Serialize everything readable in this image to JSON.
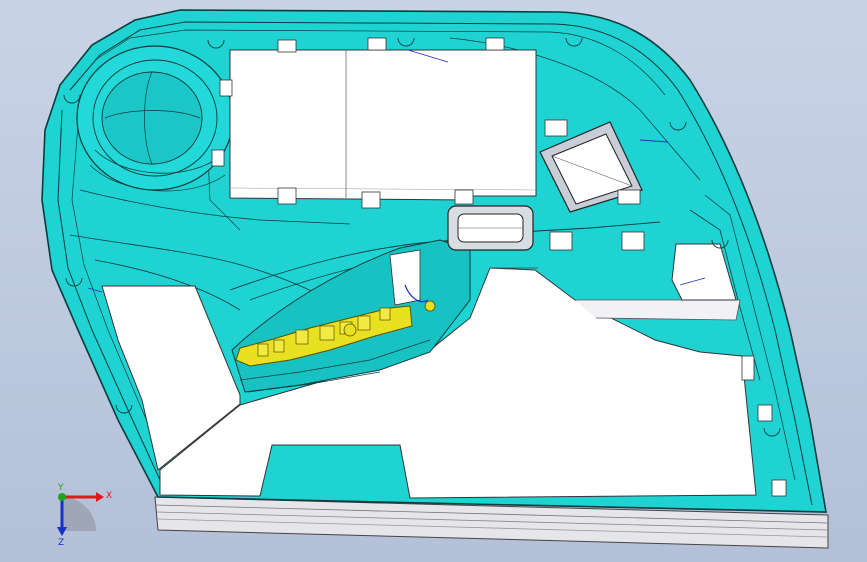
{
  "scene": {
    "background_top": "#c9d3e6",
    "background_bottom": "#b4c0d8",
    "part_color": "#1fd3d3",
    "part_edge_color": "#0a3c3c",
    "cutout_color": "#ffffff",
    "bracket_color": "#e8e020",
    "trim_strip_color": "#e6e6ea"
  },
  "triad": {
    "x_label": "X",
    "y_label": "Y",
    "z_label": "Z",
    "x_color": "#e01818",
    "y_color": "#18a818",
    "z_color": "#1830c8"
  }
}
